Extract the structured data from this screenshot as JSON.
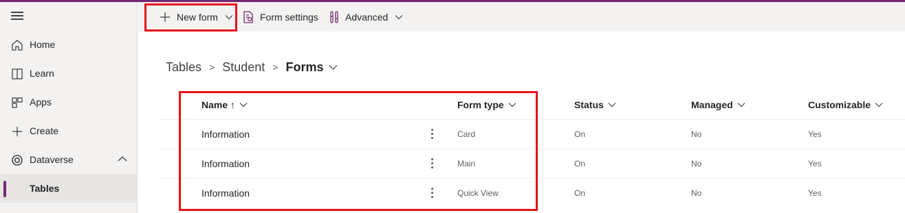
{
  "sidebar": {
    "items": [
      {
        "label": "Home",
        "icon": "home-icon"
      },
      {
        "label": "Learn",
        "icon": "book-icon"
      },
      {
        "label": "Apps",
        "icon": "apps-icon"
      },
      {
        "label": "Create",
        "icon": "plus-icon"
      },
      {
        "label": "Dataverse",
        "icon": "dataverse-icon"
      },
      {
        "label": "Tables"
      }
    ]
  },
  "toolbar": {
    "new_form": "New form",
    "form_settings": "Form settings",
    "advanced": "Advanced"
  },
  "breadcrumb": {
    "items": [
      "Tables",
      "Student",
      "Forms"
    ]
  },
  "grid": {
    "columns": [
      "Name ↑",
      "Form type",
      "Status",
      "Managed",
      "Customizable"
    ],
    "rows": [
      {
        "name": "Information",
        "form_type": "Card",
        "status": "On",
        "managed": "No",
        "customizable": "Yes"
      },
      {
        "name": "Information",
        "form_type": "Main",
        "status": "On",
        "managed": "No",
        "customizable": "Yes"
      },
      {
        "name": "Information",
        "form_type": "Quick View",
        "status": "On",
        "managed": "No",
        "customizable": "Yes"
      }
    ]
  },
  "colors": {
    "accent": "#742774",
    "highlight": "#e8101a"
  }
}
